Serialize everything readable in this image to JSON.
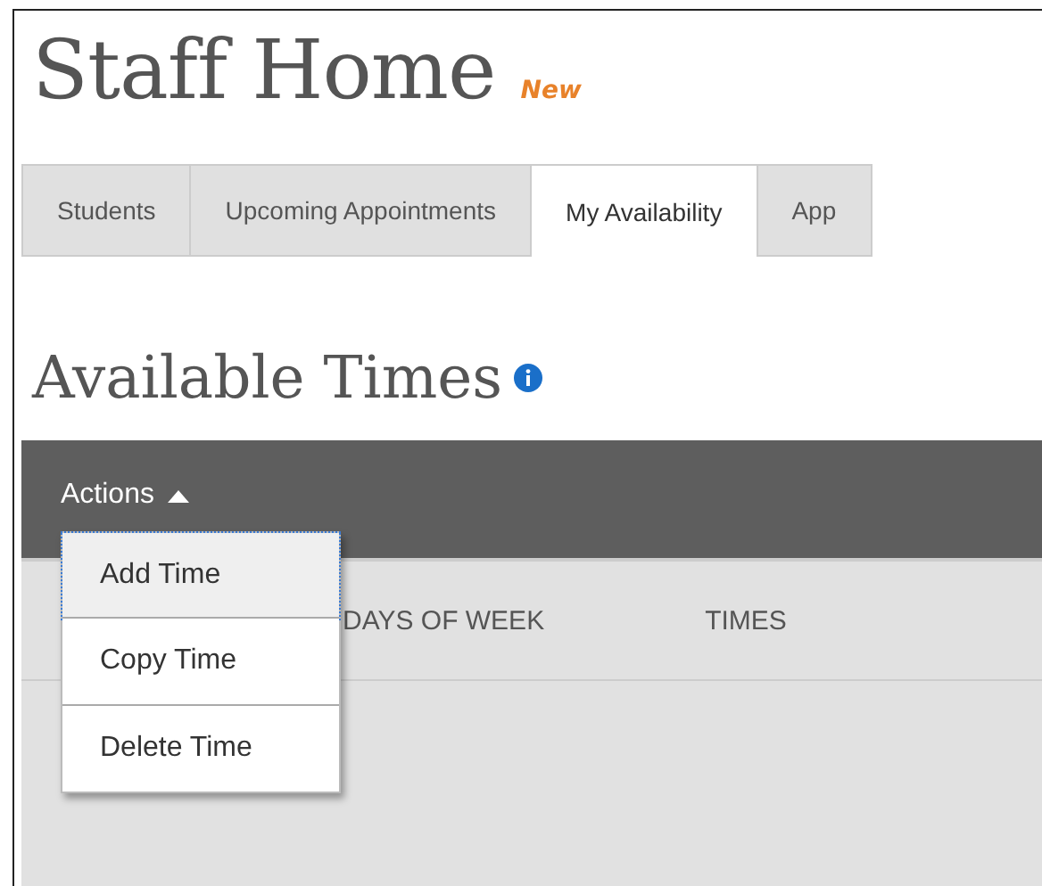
{
  "page_title": "Staff Home",
  "title_badge": "New",
  "tabs": [
    {
      "label": "Students",
      "selected": false
    },
    {
      "label": "Upcoming Appointments",
      "selected": false
    },
    {
      "label": "My Availability",
      "selected": true
    },
    {
      "label": "App",
      "selected": false
    }
  ],
  "section_title": "Available Times",
  "actions_menu": {
    "label": "Actions",
    "expanded": true,
    "items": [
      {
        "label": "Add Time",
        "selected": true
      },
      {
        "label": "Copy Time",
        "selected": false
      },
      {
        "label": "Delete Time",
        "selected": false
      }
    ]
  },
  "table": {
    "columns": [
      "DAYS OF WEEK",
      "TIMES"
    ]
  }
}
